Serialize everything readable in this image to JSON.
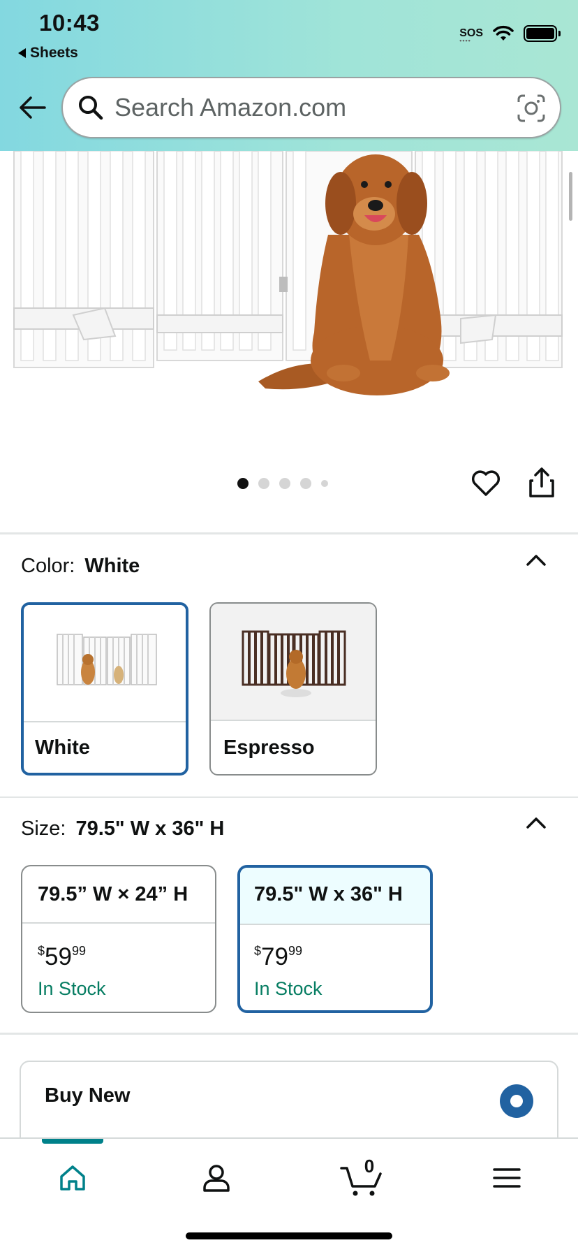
{
  "status_bar": {
    "time": "10:43",
    "back_app": "Sheets",
    "sos": "SOS"
  },
  "header": {
    "search_placeholder": "Search Amazon.com"
  },
  "gallery": {
    "image_count": 5,
    "active_index": 0
  },
  "color_selector": {
    "label": "Color:",
    "selected": "White",
    "options": [
      {
        "name": "White"
      },
      {
        "name": "Espresso"
      }
    ]
  },
  "size_selector": {
    "label": "Size:",
    "selected": "79.5\" W x 36\" H",
    "options": [
      {
        "name": "79.5” W × 24” H",
        "price_symbol": "$",
        "price_whole": "59",
        "price_fraction": "99",
        "stock": "In Stock"
      },
      {
        "name": "79.5\" W x 36\" H",
        "price_symbol": "$",
        "price_whole": "79",
        "price_fraction": "99",
        "stock": "In Stock"
      }
    ]
  },
  "buy_box": {
    "title": "Buy New"
  },
  "tab_bar": {
    "cart_count": "0"
  },
  "colors": {
    "accent_blue": "#2162a1",
    "in_stock_green": "#067d62",
    "tab_active": "#00818a",
    "header_gradient_start": "#83d8e0",
    "header_gradient_end": "#a9e6d4"
  }
}
